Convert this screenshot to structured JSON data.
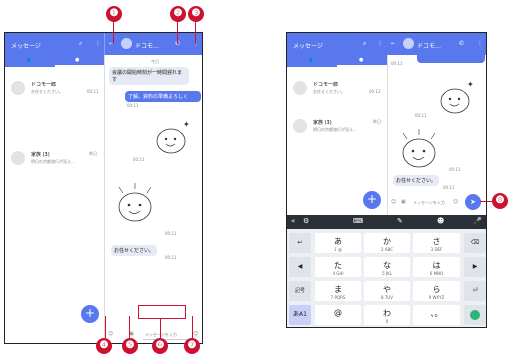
{
  "left": {
    "list_title": "メッセージ",
    "conv_title": "ドコモ…",
    "conversations": [
      {
        "name": "ドコモ一郎",
        "preview": "お任せください。",
        "time": "00:11"
      },
      {
        "name": "家族 (3)",
        "preview": "明日の京都旅行が見え…",
        "time": "昨日"
      }
    ],
    "date_label": "今日",
    "messages": {
      "incoming1": "会議の開始時刻が一時間遅れます",
      "outgoing1": "了解。資料の準備よろしく",
      "outgoing1_time": "00:11",
      "sticker1_time": "00:11",
      "sticker2_time": "00:11",
      "reply": "お任せください。",
      "reply_time": "00:11"
    },
    "input_placeholder": "メッセージを入力",
    "fab": "+"
  },
  "right": {
    "list_title": "メッセージ",
    "conv_title": "ドコモ…",
    "conversations": [
      {
        "name": "ドコモ一郎",
        "preview": "お任せください。",
        "time": "00:12"
      },
      {
        "name": "家族 (3)",
        "preview": "明日の京都旅行が見え…",
        "time": "昨日"
      }
    ],
    "top_time": "00:11",
    "sticker_time": "00:11",
    "sticker2_time": "00:11",
    "reply": "お任せください。",
    "reply_time": "00:11",
    "input_placeholder": "メッセージを入力",
    "fab": "+",
    "keyboard": {
      "row1": [
        {
          "big": "あ",
          "small": "1 @"
        },
        {
          "big": "か",
          "small": "2 ABC"
        },
        {
          "big": "さ",
          "small": "3 DEF"
        }
      ],
      "row2": [
        {
          "big": "た",
          "small": "4 GHI"
        },
        {
          "big": "な",
          "small": "5 JKL"
        },
        {
          "big": "は",
          "small": "6 MNO"
        }
      ],
      "row3": [
        {
          "big": "ま",
          "small": "7 PQRS"
        },
        {
          "big": "や",
          "small": "8 TUV"
        },
        {
          "big": "ら",
          "small": "9 WXYZ"
        }
      ],
      "row4": [
        {
          "big": "@",
          "small": ""
        },
        {
          "big": "わ",
          "small": "0"
        },
        {
          "big": "、。",
          "small": ""
        }
      ],
      "left_keys": [
        "↩",
        "◀",
        "記号",
        "あA1"
      ],
      "right_keys": [
        "⌫",
        "▶",
        "⏎",
        ""
      ]
    }
  },
  "callouts": [
    "❶",
    "❷",
    "❸",
    "❹",
    "❺",
    "❻",
    "❼",
    "❽"
  ]
}
